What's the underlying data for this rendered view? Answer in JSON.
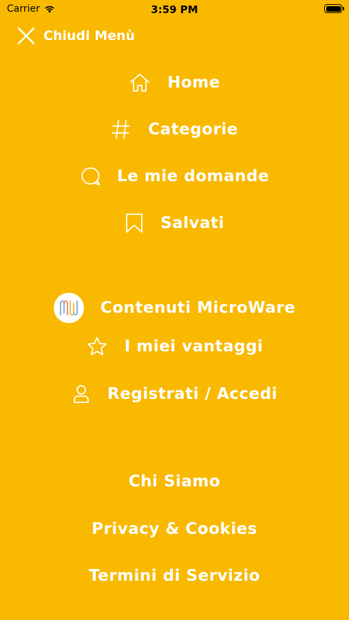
{
  "status_bar": {
    "carrier": "Carrier",
    "time": "3:59 PM"
  },
  "header": {
    "close_label": "Chiudi Menù"
  },
  "menu": {
    "home": "Home",
    "categorie": "Categorie",
    "domande": "Le mie domande",
    "salvati": "Salvati",
    "microware": "Contenuti MicroWare",
    "vantaggi": "I miei vantaggi",
    "registrati": "Registrati / Accedi"
  },
  "footer": {
    "chi_siamo": "Chi Siamo",
    "privacy": "Privacy & Cookies",
    "termini": "Termini di Servizio"
  },
  "colors": {
    "background": "#F8B900",
    "text": "#FFFFFF"
  }
}
